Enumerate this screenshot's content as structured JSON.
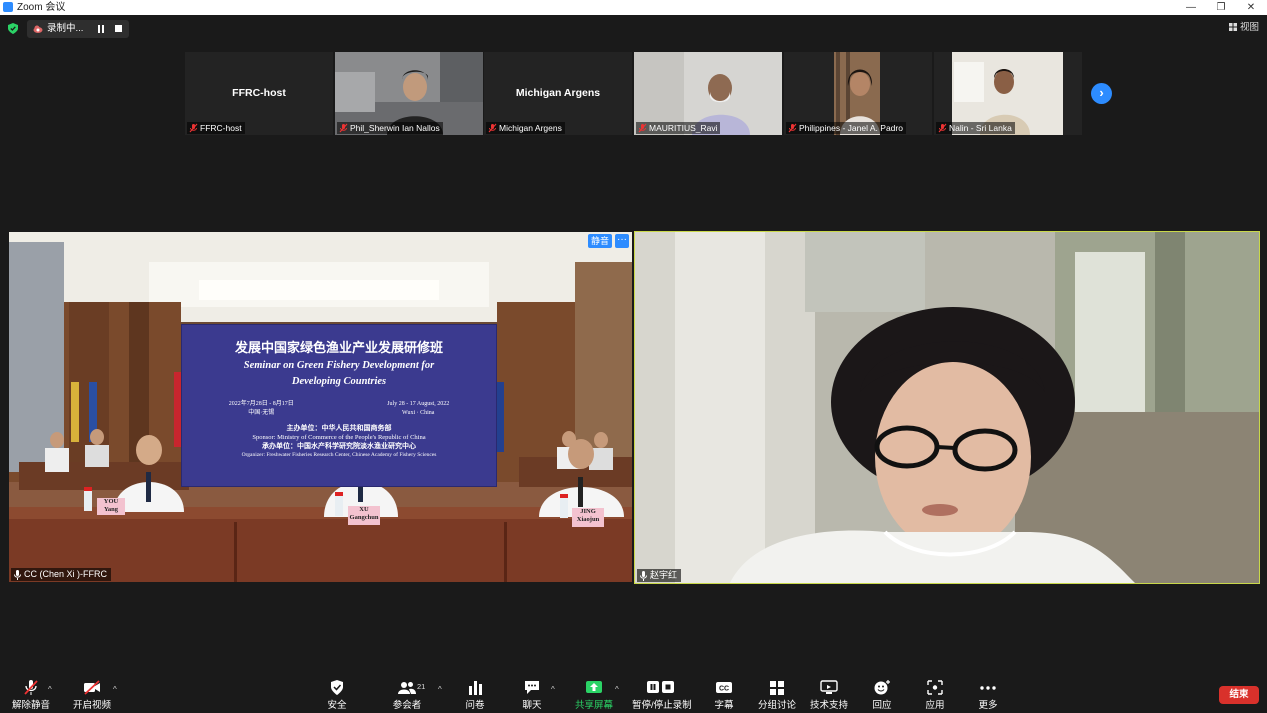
{
  "window": {
    "title": "Zoom 会议",
    "controls": [
      "minimize",
      "restore",
      "close"
    ]
  },
  "topbar": {
    "recording_label": "录制中...",
    "view_label": "视图"
  },
  "thumbnails": [
    {
      "name": "FFRC-host",
      "center_name": "FFRC-host",
      "video_on": false,
      "muted": true
    },
    {
      "name": "Phil_Sherwin Ian Nallos",
      "center_name": "",
      "video_on": true,
      "muted": true
    },
    {
      "name": "Michigan Argens",
      "center_name": "Michigan Argens",
      "video_on": false,
      "muted": true
    },
    {
      "name": "MAURITIUS_Ravi",
      "center_name": "",
      "video_on": true,
      "muted": true
    },
    {
      "name": "Philippines - Janel A. Padro",
      "center_name": "",
      "video_on": true,
      "muted": true
    },
    {
      "name": "Nalin - Sri Lanka",
      "center_name": "",
      "video_on": true,
      "muted": true
    }
  ],
  "main_videos": {
    "left": {
      "name": "CC (Chen Xi )-FFRC",
      "mute_badge": "静音",
      "more_badge": "···",
      "banner": {
        "title_cn": "发展中国家绿色渔业产业发展研修班",
        "title_en_1": "Seminar on Green Fishery Development for",
        "title_en_2": "Developing Countries",
        "date_cn": "2022年7月28日 - 8月17日",
        "place_cn": "中国·无锡",
        "date_en": "July 28 - 17 August, 2022",
        "place_en": "Wuxi · China",
        "sponsor_cn": "主办单位：中华人民共和国商务部",
        "sponsor_en": "Sponsor: Ministry of Commerce of the People's Republic of China",
        "organizer_cn": "承办单位：中国水产科学研究院淡水渔业研究中心",
        "organizer_en": "Organizer: Freshwater Fisheries Research Center, Chinese Academy of Fishery Sciences"
      },
      "desk_labels": [
        {
          "line1": "YOU",
          "line2": "Yang"
        },
        {
          "line1": "XU",
          "line2": "Gangchun"
        },
        {
          "line1": "JING",
          "line2": "Xiaojun"
        }
      ]
    },
    "right": {
      "name": "赵宇红"
    }
  },
  "toolbar": {
    "items": [
      {
        "label": "解除静音",
        "icon": "muted-mic-icon"
      },
      {
        "label": "开启视频",
        "icon": "video-off-icon"
      },
      {
        "label": "安全",
        "icon": "shield-icon"
      },
      {
        "label": "参会者",
        "icon": "participants-icon",
        "count": "21"
      },
      {
        "label": "问卷",
        "icon": "poll-icon"
      },
      {
        "label": "聊天",
        "icon": "chat-icon"
      },
      {
        "label": "共享屏幕",
        "icon": "share-screen-icon"
      },
      {
        "label": "暂停/停止录制",
        "icon": "pause-stop-record-icon"
      },
      {
        "label": "字幕",
        "icon": "cc-icon"
      },
      {
        "label": "分组讨论",
        "icon": "breakout-icon"
      },
      {
        "label": "技术支持",
        "icon": "remote-support-icon"
      },
      {
        "label": "回应",
        "icon": "reaction-icon"
      },
      {
        "label": "应用",
        "icon": "apps-icon"
      },
      {
        "label": "更多",
        "icon": "more-icon"
      }
    ],
    "end_label": "结束"
  },
  "colors": {
    "accent": "#2d8cff",
    "share_green": "#2bd366",
    "end_red": "#d9312b",
    "active_speaker_border": "#c9d84a"
  }
}
